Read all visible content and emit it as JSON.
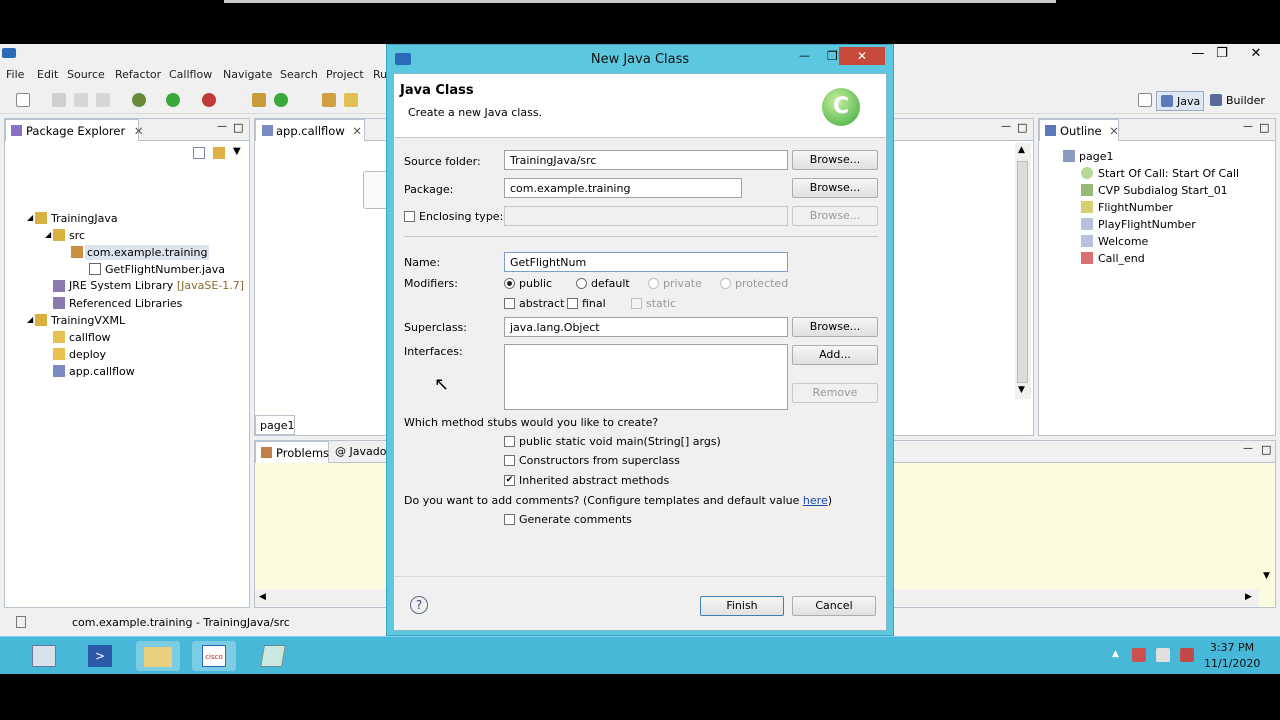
{
  "ide": {
    "menu": [
      "File",
      "Edit",
      "Source",
      "Refactor",
      "Callflow",
      "Navigate",
      "Search",
      "Project",
      "Ru"
    ],
    "perspectives": {
      "java": "Java",
      "builder": "Builder"
    },
    "package_explorer": {
      "tab": "Package Explorer",
      "tree": [
        {
          "label": "TrainingJava",
          "icon": "project-icon"
        },
        {
          "label": "src",
          "icon": "source-folder-icon"
        },
        {
          "label": "com.example.training",
          "icon": "package-icon"
        },
        {
          "label": "GetFlightNumber.java",
          "icon": "java-file-icon"
        },
        {
          "label": "JRE System Library",
          "suffix": "[JavaSE-1.7]",
          "icon": "library-icon"
        },
        {
          "label": "Referenced Libraries",
          "icon": "library-icon"
        },
        {
          "label": "TrainingVXML",
          "icon": "project-icon"
        },
        {
          "label": "callflow",
          "icon": "folder-icon"
        },
        {
          "label": "deploy",
          "icon": "folder-icon"
        },
        {
          "label": "app.callflow",
          "icon": "callflow-file-icon"
        }
      ]
    },
    "editor": {
      "tab": "app.callflow",
      "page_tab": "page1"
    },
    "bottom_tabs": {
      "problems": "Problems",
      "javadoc": "Javadoc"
    },
    "outline": {
      "tab": "Outline",
      "root": "page1",
      "items": [
        "Start Of Call: Start Of Call",
        "CVP Subdialog Start_01",
        "FlightNumber",
        "PlayFlightNumber",
        "Welcome",
        "Call_end"
      ]
    },
    "status": "com.example.training - TrainingJava/src"
  },
  "dialog": {
    "title": "New Java Class",
    "header_title": "Java Class",
    "header_desc": "Create a new Java class.",
    "source_folder": {
      "label": "Source folder:",
      "value": "TrainingJava/src",
      "browse": "Browse..."
    },
    "package": {
      "label": "Package:",
      "value": "com.example.training",
      "browse": "Browse..."
    },
    "enclosing": {
      "label": "Enclosing type:",
      "value": "",
      "browse": "Browse..."
    },
    "name": {
      "label": "Name:",
      "value": "GetFlightNum"
    },
    "modifiers": {
      "label": "Modifiers:",
      "public": "public",
      "default": "default",
      "private": "private",
      "protected": "protected",
      "abstract": "abstract",
      "final": "final",
      "static": "static",
      "selected": "public"
    },
    "superclass": {
      "label": "Superclass:",
      "value": "java.lang.Object",
      "browse": "Browse..."
    },
    "interfaces": {
      "label": "Interfaces:",
      "add": "Add...",
      "remove": "Remove"
    },
    "stubs": {
      "question": "Which method stubs would you like to create?",
      "main": "public static void main(String[] args)",
      "constructors": "Constructors from superclass",
      "inherited": "Inherited abstract methods",
      "inherited_checked": true
    },
    "comments": {
      "question": "Do you want to add comments? (Configure templates and default value ",
      "link": "here",
      "close": ")",
      "generate": "Generate comments"
    },
    "finish": "Finish",
    "cancel": "Cancel"
  },
  "taskbar": {
    "time": "3:37 PM",
    "date": "11/1/2020"
  },
  "colors": {
    "dialog_frame": "#5cc8e0",
    "taskbar": "#48b8d8",
    "problems_bg": "#fbfbde"
  }
}
